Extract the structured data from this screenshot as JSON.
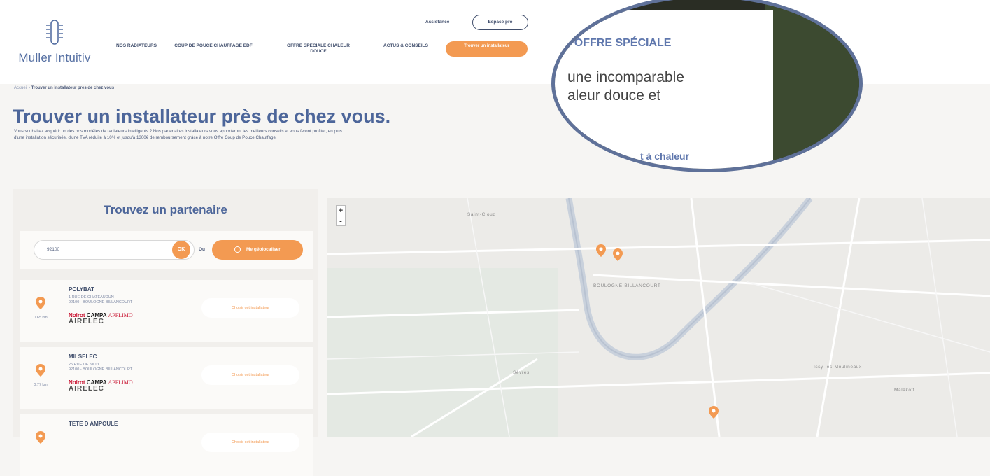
{
  "header": {
    "logo_text": "Muller Intuitiv",
    "assistance": "Assistance",
    "espace_pro": "Espace pro",
    "nav": [
      {
        "label": "NOS RADIATEURS"
      },
      {
        "label": "COUP DE POUCE CHAUFFAGE EDF"
      },
      {
        "label": "OFFRE SPÉCIALE CHALEUR DOUCE"
      },
      {
        "label": "ACTUS & CONSEILS"
      }
    ],
    "cta": "Trouver un installateur"
  },
  "breadcrumb": {
    "home": "Accueil",
    "separator": "›",
    "current": "Trouver un installateur près de chez vous"
  },
  "page": {
    "title": "Trouver un installateur près de chez vous.",
    "intro": "Vous souhaitez acquérir un des nos modèles de radiateurs intelligents ? Nos partenaires installateurs vous apporteront les meilleurs conseils et vous feront profiter, en plus d'une installation sécurisée, d'une TVA réduite à 10% et jusqu'à 1300€ de remboursement grâce à notre Offre Coup de Pouce Chauffage."
  },
  "partner_panel": {
    "title": "Trouvez un partenaire",
    "search": {
      "value": "92100",
      "ok": "OK",
      "or": "Ou",
      "geo": "Me géolocaliser"
    },
    "results": [
      {
        "name": "POLYBAT",
        "street": "1 RUE DE CHATEAUDUN",
        "city": "92100 - BOULOGNE BILLANCOURT",
        "distance": "0.65 km",
        "choose": "Choisir cet installateur"
      },
      {
        "name": "MILSELEC",
        "street": "25 RUE DE SILLY",
        "city": "92100 - BOULOGNE BILLANCOURT",
        "distance": "0.77 km",
        "choose": "Choisir cet installateur"
      },
      {
        "name": "TETE D AMPOULE",
        "street": "",
        "city": "",
        "distance": "",
        "choose": "Choisir cet installateur"
      }
    ],
    "brands": {
      "noirot": "Noirot",
      "campa": "CAMPA",
      "applimo": "APPLIMO",
      "airelec": "AIRELEC"
    }
  },
  "map": {
    "zoom_in": "+",
    "zoom_out": "-",
    "labels": [
      "BOULOGNE-BILLANCOURT",
      "Sèvres",
      "Issy-les-Moulineaux",
      "Malakoff",
      "Saint-Cloud"
    ]
  },
  "magnifier": {
    "title": ": OFFRE SPÉCIALE",
    "line1": "une incomparable",
    "line2": "aleur douce et",
    "link": "t à chaleur"
  }
}
